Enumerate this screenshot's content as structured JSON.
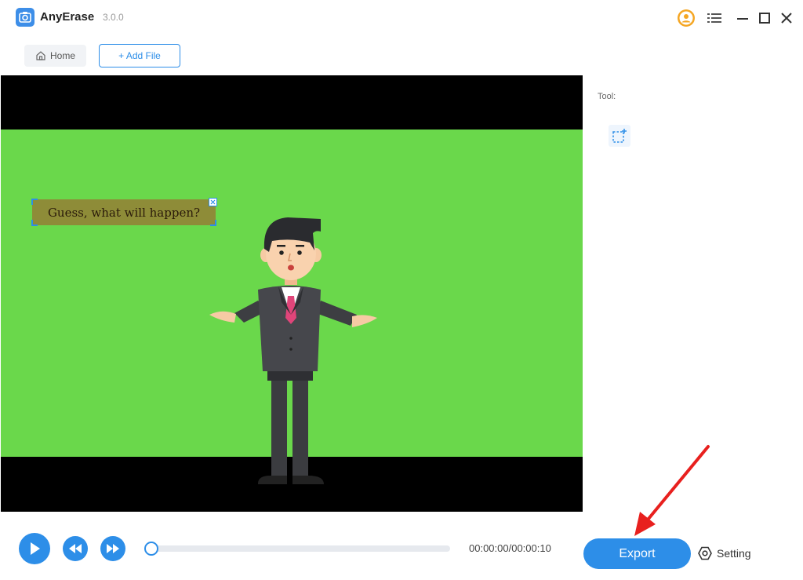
{
  "app": {
    "name": "AnyErase",
    "version": "3.0.0"
  },
  "toolbar": {
    "home_label": "Home",
    "add_file_label": "+ Add File"
  },
  "video": {
    "caption_text": "Guess, what will happen?"
  },
  "tool_panel": {
    "label": "Tool:",
    "tools": [
      "rect-select-icon"
    ]
  },
  "playback": {
    "time": "00:00:00/00:00:10",
    "progress": 0.0
  },
  "actions": {
    "export_label": "Export",
    "setting_label": "Setting"
  },
  "colors": {
    "accent": "#2d8ee8",
    "green_screen": "#6ad84b",
    "caption_bg": "#8e8c38",
    "annotation_arrow": "#e8201e"
  },
  "icons": {
    "logo": "camera-icon",
    "account": "user-circle-icon",
    "menu": "hamburger-icon",
    "home": "house-icon",
    "setting": "gear-icon"
  }
}
